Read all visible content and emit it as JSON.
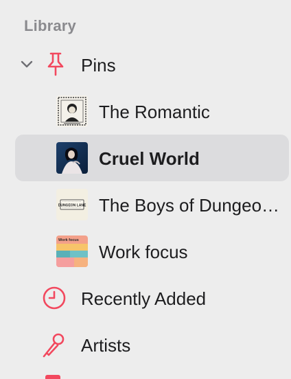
{
  "library": {
    "header": "Library",
    "pins": {
      "label": "Pins",
      "items": [
        {
          "label": "The Romantic"
        },
        {
          "label": "Cruel World"
        },
        {
          "label": "The Boys of Dungeon Lane"
        },
        {
          "label": "Work focus"
        }
      ]
    },
    "recently_added": {
      "label": "Recently Added"
    },
    "artists": {
      "label": "Artists"
    }
  },
  "thumbs": {
    "dungeon_title": "DUNGEON LANE",
    "work_focus_title": "Work focus"
  },
  "colors": {
    "accent": "#f2485e",
    "selected_row": "#dcdcde",
    "background": "#ededed",
    "header_text": "#8a8a8e"
  },
  "selected_item": "Cruel World"
}
